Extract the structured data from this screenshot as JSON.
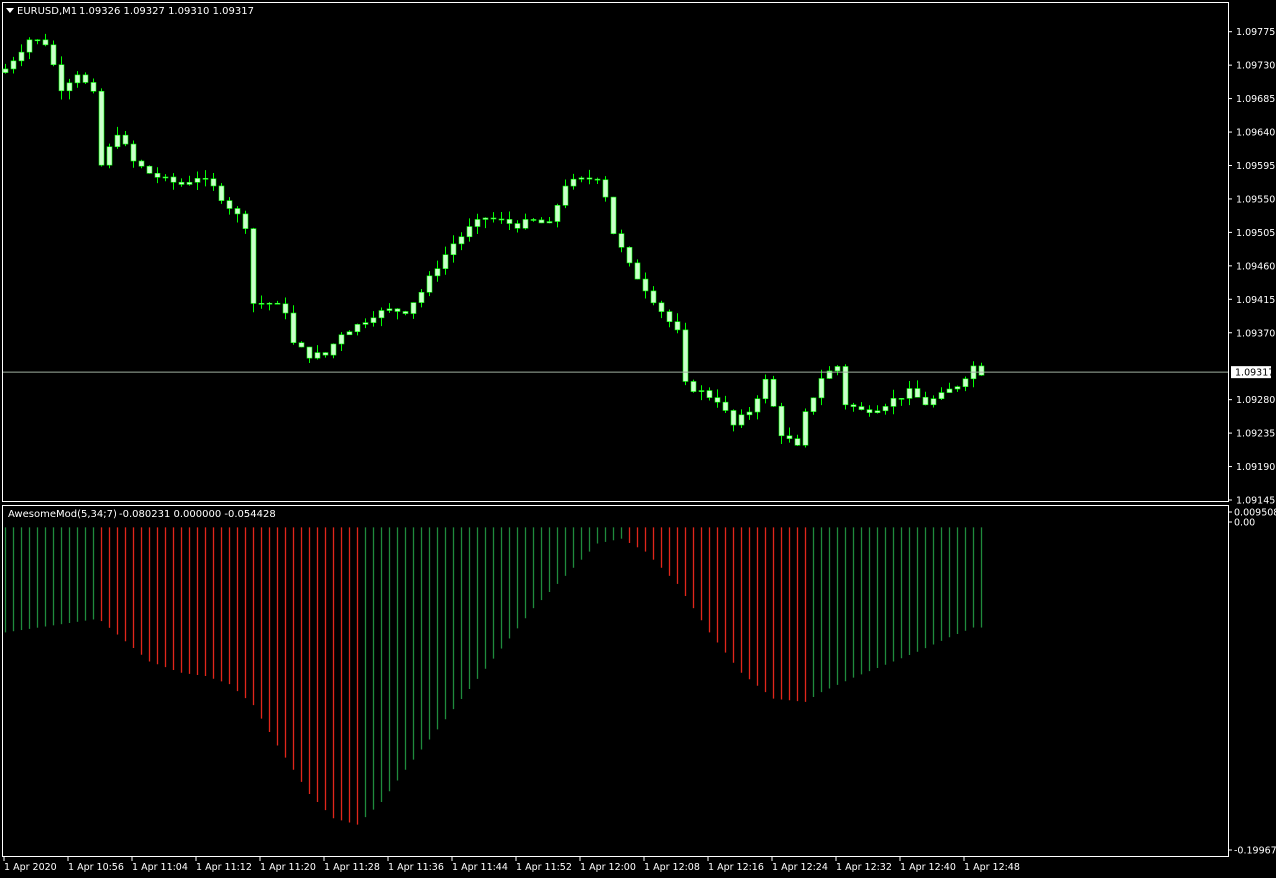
{
  "main_legend": {
    "symbol": "EURUSD,M1",
    "ohlc": "1.09326 1.09327 1.09310 1.09317"
  },
  "indicator_legend": {
    "name": "AwesomeMod(5,34;7)",
    "values": "-0.080231 0.000000 -0.054428"
  },
  "current_price_label": "1.09317",
  "colors": {
    "background": "#000000",
    "frame": "#ffffff",
    "candle": "#ccffcc",
    "wick": "#00ff00",
    "price_line": "#a0b0a0",
    "ao_up": "#1f8a3c",
    "ao_down": "#e0261b"
  },
  "chart_data": [
    {
      "type": "candlestick",
      "title": "EURUSD,M1",
      "timeframe": "M1",
      "ylim": [
        1.09145,
        1.09815
      ],
      "price_ticks": [
        "1.09775",
        "1.09730",
        "1.09685",
        "1.09640",
        "1.09595",
        "1.09550",
        "1.09505",
        "1.09460",
        "1.09415",
        "1.09370",
        "1.09325",
        "1.09280",
        "1.09235",
        "1.09190",
        "1.09145"
      ],
      "current_price": 1.09317,
      "x_labels": [
        "1 Apr 2020",
        "1 Apr 10:56",
        "1 Apr 11:04",
        "1 Apr 11:12",
        "1 Apr 11:20",
        "1 Apr 11:28",
        "1 Apr 11:36",
        "1 Apr 11:44",
        "1 Apr 11:52",
        "1 Apr 12:00",
        "1 Apr 12:08",
        "1 Apr 12:16",
        "1 Apr 12:24",
        "1 Apr 12:32",
        "1 Apr 12:40",
        "1 Apr 12:48"
      ],
      "close_path": [
        [
          0,
          1.09725
        ],
        [
          3,
          1.09765
        ],
        [
          5,
          1.0976
        ],
        [
          7,
          1.097
        ],
        [
          9,
          1.0972
        ],
        [
          11,
          1.0969
        ],
        [
          12,
          1.09595
        ],
        [
          14,
          1.0964
        ],
        [
          16,
          1.096
        ],
        [
          18,
          1.09585
        ],
        [
          20,
          1.09575
        ],
        [
          22,
          1.0957
        ],
        [
          24,
          1.0958
        ],
        [
          26,
          1.09565
        ],
        [
          28,
          1.0954
        ],
        [
          30,
          1.09515
        ],
        [
          31,
          1.0941
        ],
        [
          33,
          1.0941
        ],
        [
          35,
          1.094
        ],
        [
          36,
          1.09355
        ],
        [
          38,
          1.0934
        ],
        [
          40,
          1.0934
        ],
        [
          42,
          1.0937
        ],
        [
          44,
          1.0938
        ],
        [
          46,
          1.09395
        ],
        [
          48,
          1.094
        ],
        [
          50,
          1.094
        ],
        [
          52,
          1.09425
        ],
        [
          54,
          1.0946
        ],
        [
          56,
          1.0949
        ],
        [
          58,
          1.0951
        ],
        [
          60,
          1.09525
        ],
        [
          62,
          1.0952
        ],
        [
          64,
          1.09515
        ],
        [
          66,
          1.0952
        ],
        [
          68,
          1.09515
        ],
        [
          70,
          1.0957
        ],
        [
          72,
          1.09575
        ],
        [
          74,
          1.0958
        ],
        [
          75,
          1.09555
        ],
        [
          76,
          1.09505
        ],
        [
          78,
          1.0946
        ],
        [
          80,
          1.0943
        ],
        [
          82,
          1.094
        ],
        [
          84,
          1.0937
        ],
        [
          85,
          1.093
        ],
        [
          87,
          1.0929
        ],
        [
          89,
          1.0928
        ],
        [
          91,
          1.09245
        ],
        [
          93,
          1.09265
        ],
        [
          95,
          1.09305
        ],
        [
          97,
          1.09235
        ],
        [
          99,
          1.09215
        ],
        [
          100,
          1.0926
        ],
        [
          102,
          1.0931
        ],
        [
          104,
          1.09325
        ],
        [
          105,
          1.09275
        ],
        [
          107,
          1.09265
        ],
        [
          109,
          1.0927
        ],
        [
          111,
          1.0928
        ],
        [
          113,
          1.0929
        ],
        [
          115,
          1.09275
        ],
        [
          117,
          1.09285
        ],
        [
          119,
          1.093
        ],
        [
          121,
          1.09325
        ],
        [
          122,
          1.09317
        ]
      ]
    },
    {
      "type": "bar",
      "title": "AwesomeMod(5,34;7)",
      "ylim": [
        -0.199671,
        0.009508
      ],
      "value_ticks": [
        "0.009508",
        "0.00",
        "-0.199671"
      ],
      "legend_values": [
        -0.080231,
        0.0,
        -0.054428
      ],
      "values_path": [
        [
          0,
          -0.065
        ],
        [
          11,
          -0.057
        ],
        [
          12,
          -0.058
        ],
        [
          18,
          -0.083
        ],
        [
          22,
          -0.09
        ],
        [
          25,
          -0.092
        ],
        [
          28,
          -0.097
        ],
        [
          31,
          -0.11
        ],
        [
          34,
          -0.135
        ],
        [
          38,
          -0.165
        ],
        [
          41,
          -0.18
        ],
        [
          44,
          -0.184
        ],
        [
          47,
          -0.17
        ],
        [
          50,
          -0.15
        ],
        [
          54,
          -0.125
        ],
        [
          58,
          -0.1
        ],
        [
          62,
          -0.075
        ],
        [
          66,
          -0.05
        ],
        [
          70,
          -0.03
        ],
        [
          74,
          -0.01
        ],
        [
          77,
          -0.007
        ],
        [
          80,
          -0.015
        ],
        [
          84,
          -0.035
        ],
        [
          88,
          -0.065
        ],
        [
          92,
          -0.09
        ],
        [
          96,
          -0.106
        ],
        [
          100,
          -0.108
        ],
        [
          102,
          -0.102
        ],
        [
          106,
          -0.093
        ],
        [
          110,
          -0.085
        ],
        [
          114,
          -0.077
        ],
        [
          118,
          -0.068
        ],
        [
          121,
          -0.062
        ]
      ]
    }
  ]
}
